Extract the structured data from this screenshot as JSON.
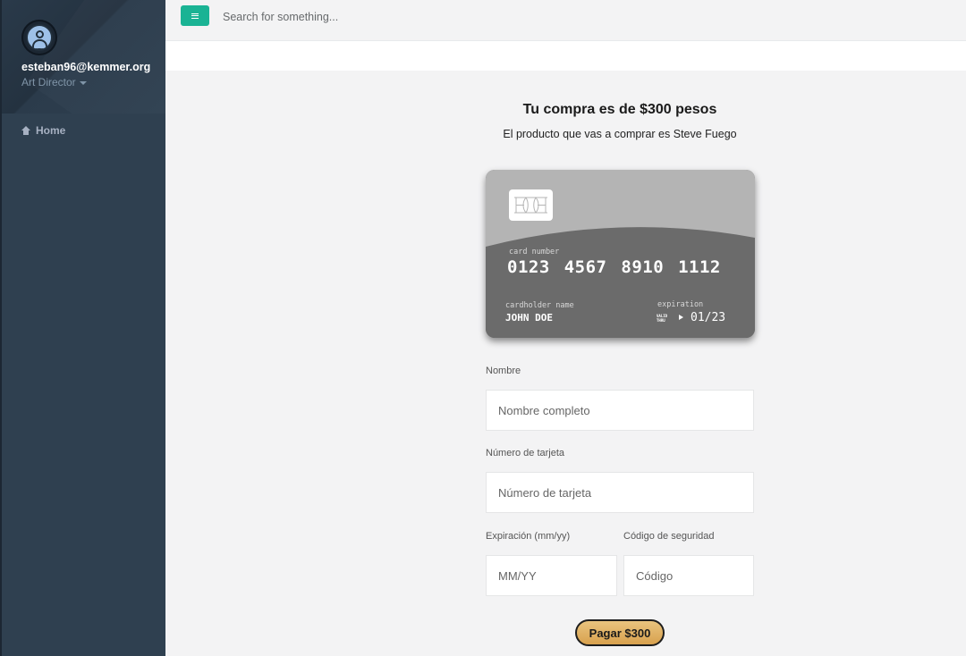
{
  "sidebar": {
    "user_email": "esteban96@kemmer.org",
    "user_role": "Art Director",
    "items": [
      {
        "label": "Home",
        "icon": "home-icon"
      }
    ]
  },
  "topbar": {
    "search_placeholder": "Search for something...",
    "accent": "#1ab394"
  },
  "main": {
    "title": "Tu compra es de $300 pesos",
    "subtitle": "El producto que vas a comprar es Steve Fuego"
  },
  "card": {
    "number_label": "card number",
    "number": "0123 4567 8910 1112",
    "holder_label": "cardholder name",
    "holder": "JOHN DOE",
    "expiration_label": "expiration",
    "valid_line1": "VALID",
    "valid_line2": "THRU",
    "expiration": "01/23"
  },
  "form": {
    "name_label": "Nombre",
    "name_placeholder": "Nombre completo",
    "card_label": "Número de tarjeta",
    "card_placeholder": "Número de tarjeta",
    "exp_label": "Expiración (mm/yy)",
    "exp_placeholder": "MM/YY",
    "cvv_label": "Código de seguridad",
    "cvv_placeholder": "Código",
    "pay_button": "Pagar $300"
  }
}
